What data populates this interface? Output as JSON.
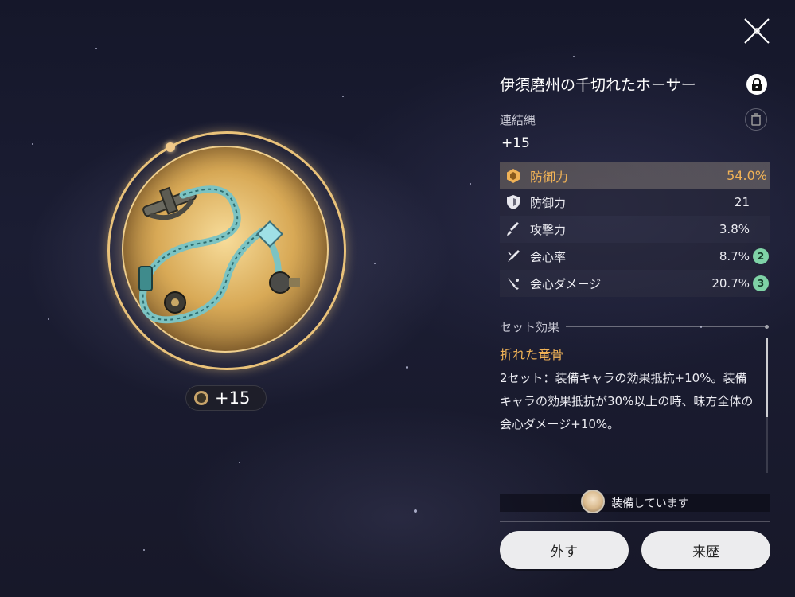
{
  "relic": {
    "name": "伊須磨州の千切れたホーサー",
    "type": "連結縄",
    "level": "+15",
    "level_badge": "+15"
  },
  "main_stat": {
    "name": "防御力",
    "value": "54.0%",
    "icon": "defense-hex-icon"
  },
  "sub_stats": [
    {
      "name": "防御力",
      "value": "21",
      "icon": "shield-icon",
      "rolls": ""
    },
    {
      "name": "攻撃力",
      "value": "3.8%",
      "icon": "sword-icon",
      "rolls": ""
    },
    {
      "name": "会心率",
      "value": "8.7%",
      "icon": "crit-rate-icon",
      "rolls": "2"
    },
    {
      "name": "会心ダメージ",
      "value": "20.7%",
      "icon": "crit-dmg-icon",
      "rolls": "3"
    }
  ],
  "set_effect": {
    "header": "セット効果",
    "name": "折れた竜骨",
    "description": "2セット：装備キャラの効果抵抗+10%。装備キャラの効果抵抗が30%以上の時、味方全体の会心ダメージ+10%。"
  },
  "equipped": {
    "text": "装備しています"
  },
  "buttons": {
    "unequip": "外す",
    "history": "来歴"
  },
  "colors": {
    "accent": "#f0b256",
    "badge": "#7fd3a6",
    "ring": "#e9c27a"
  }
}
